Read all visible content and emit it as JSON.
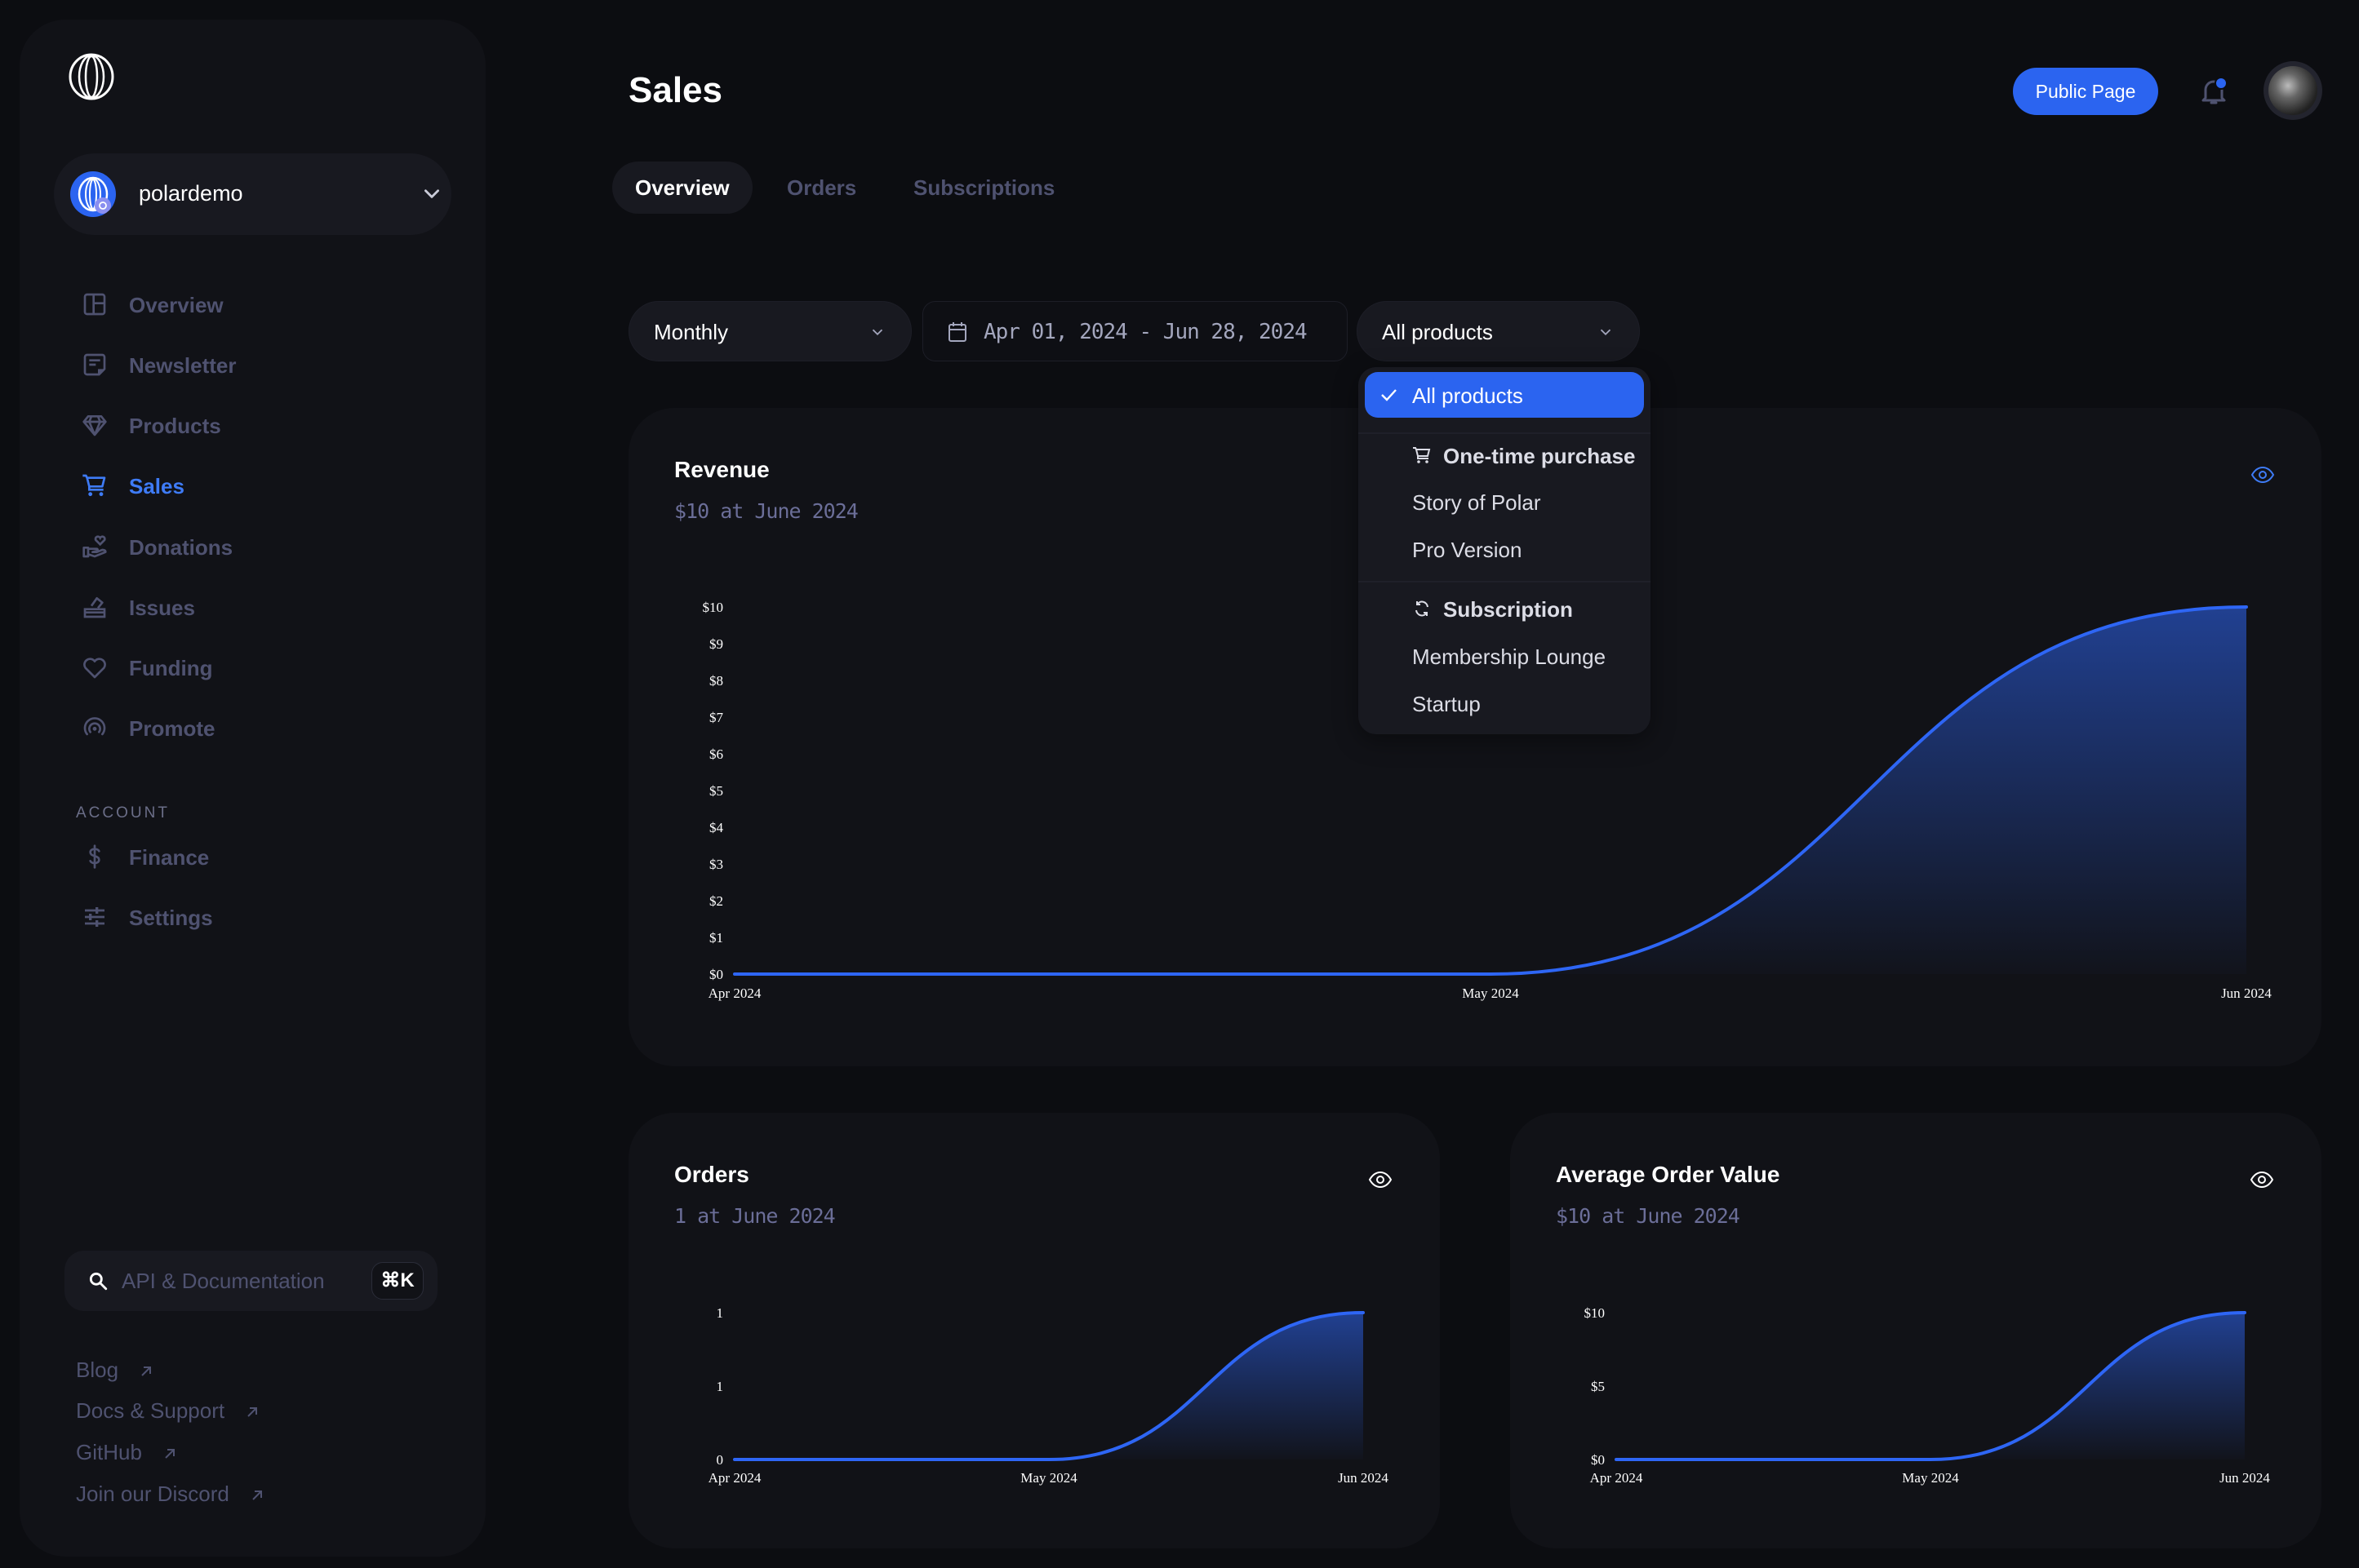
{
  "sidebar": {
    "org_name": "polardemo",
    "nav": [
      {
        "label": "Overview",
        "icon": "layout-icon",
        "active": false
      },
      {
        "label": "Newsletter",
        "icon": "newsletter-icon",
        "active": false
      },
      {
        "label": "Products",
        "icon": "diamond-icon",
        "active": false
      },
      {
        "label": "Sales",
        "icon": "cart-icon",
        "active": true
      },
      {
        "label": "Donations",
        "icon": "hand-heart-icon",
        "active": false
      },
      {
        "label": "Issues",
        "icon": "issues-icon",
        "active": false
      },
      {
        "label": "Funding",
        "icon": "heart-icon",
        "active": false
      },
      {
        "label": "Promote",
        "icon": "broadcast-icon",
        "active": false
      }
    ],
    "account_label": "ACCOUNT",
    "account_nav": [
      {
        "label": "Finance",
        "icon": "dollar-icon"
      },
      {
        "label": "Settings",
        "icon": "sliders-icon"
      }
    ],
    "search_placeholder": "API & Documentation",
    "search_shortcut": "⌘K",
    "links": [
      "Blog",
      "Docs & Support",
      "GitHub",
      "Join our Discord"
    ]
  },
  "header": {
    "title": "Sales",
    "tabs": [
      "Overview",
      "Orders",
      "Subscriptions"
    ],
    "active_tab": "Overview",
    "public_page_label": "Public Page",
    "notification_dot": true
  },
  "filters": {
    "interval": "Monthly",
    "date_range": "Apr 01, 2024 - Jun 28, 2024",
    "product": "All products"
  },
  "product_dropdown": {
    "selected": "All products",
    "groups": [
      {
        "label": "One-time purchase",
        "icon": "cart-icon",
        "items": [
          "Story of Polar",
          "Pro Version"
        ]
      },
      {
        "label": "Subscription",
        "icon": "refresh-icon",
        "items": [
          "Membership Lounge",
          "Startup"
        ]
      }
    ]
  },
  "colors": {
    "accent": "#2b64f0",
    "line": "#2e66f5",
    "card_bg": "#111217",
    "page_bg": "#0c0d11",
    "muted_text": "#4f5270"
  },
  "chart_data": [
    {
      "type": "area",
      "title": "Revenue",
      "subtitle": "$10 at June 2024",
      "categories": [
        "Apr 2024",
        "May 2024",
        "Jun 2024"
      ],
      "values": [
        0,
        0,
        10
      ],
      "y_ticks": [
        "$0",
        "$1",
        "$2",
        "$3",
        "$4",
        "$5",
        "$6",
        "$7",
        "$8",
        "$9",
        "$10"
      ],
      "ylim": [
        0,
        10
      ],
      "eye_active": true
    },
    {
      "type": "area",
      "title": "Orders",
      "subtitle": "1 at June 2024",
      "categories": [
        "Apr 2024",
        "May 2024",
        "Jun 2024"
      ],
      "values": [
        0,
        0,
        1
      ],
      "y_ticks": [
        "0",
        "1",
        "1"
      ],
      "ylim": [
        0,
        1
      ],
      "eye_active": false
    },
    {
      "type": "area",
      "title": "Average Order Value",
      "subtitle": "$10 at June 2024",
      "categories": [
        "Apr 2024",
        "May 2024",
        "Jun 2024"
      ],
      "values": [
        0,
        0,
        10
      ],
      "y_ticks": [
        "$0",
        "$5",
        "$10"
      ],
      "ylim": [
        0,
        10
      ],
      "eye_active": false
    }
  ]
}
